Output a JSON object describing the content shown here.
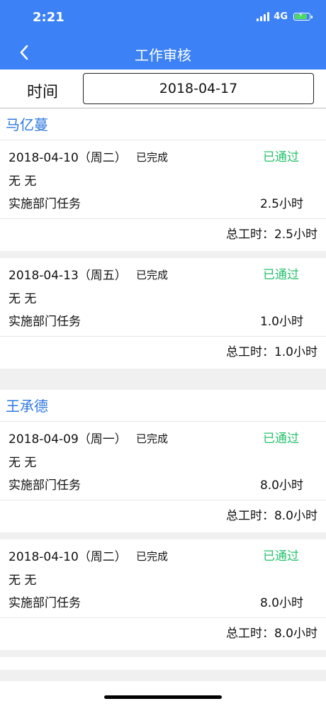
{
  "status_bar": {
    "time": "2:21",
    "network": "4G"
  },
  "header": {
    "title": "工作审核",
    "back_icon": "chevron-left-icon"
  },
  "filter": {
    "label": "时间",
    "date_value": "2018-04-17"
  },
  "people": [
    {
      "name": "马亿蔓",
      "records": [
        {
          "date": "2018-04-10（周二）",
          "state": "已完成",
          "approval": "已通过",
          "description": "无 无",
          "task": "实施部门任务",
          "hours": "2.5小时",
          "total": "总工时：2.5小时"
        },
        {
          "date": "2018-04-13（周五）",
          "state": "已完成",
          "approval": "已通过",
          "description": "无 无",
          "task": "实施部门任务",
          "hours": "1.0小时",
          "total": "总工时：1.0小时"
        }
      ]
    },
    {
      "name": "王承德",
      "records": [
        {
          "date": "2018-04-09（周一）",
          "state": "已完成",
          "approval": "已通过",
          "description": "无 无",
          "task": "实施部门任务",
          "hours": "8.0小时",
          "total": "总工时：8.0小时"
        },
        {
          "date": "2018-04-10（周二）",
          "state": "已完成",
          "approval": "已通过",
          "description": "无 无",
          "task": "实施部门任务",
          "hours": "8.0小时",
          "total": "总工时：8.0小时"
        }
      ]
    }
  ],
  "colors": {
    "header_bg": "#3c82f6",
    "name_blue": "#2f78de",
    "approved_green": "#23c26a",
    "page_bg": "#f0f0f0"
  }
}
